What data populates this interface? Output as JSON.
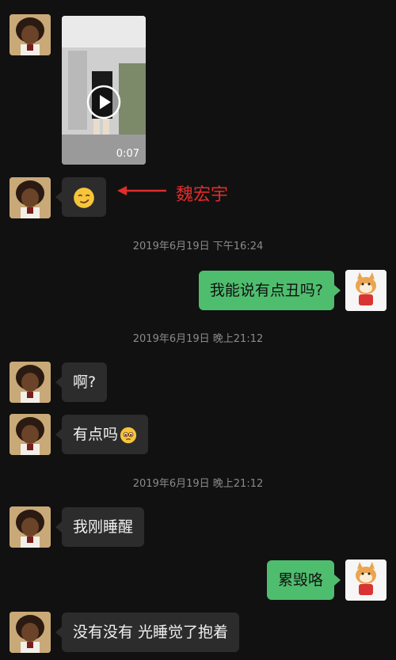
{
  "messages": {
    "video_duration": "0:07",
    "annotation_label": "魏宏宇",
    "ts1": "2019年6月19日 下午16:24",
    "msg_right1": "我能说有点丑吗?",
    "ts2": "2019年6月19日 晚上21:12",
    "msg_left1": "啊?",
    "msg_left2": "有点吗",
    "ts3": "2019年6月19日 晚上21:12",
    "msg_left3": "我刚睡醒",
    "msg_right2": "累毁咯",
    "msg_left4": "没有没有 光睡觉了抱着"
  },
  "colors": {
    "background": "#111111",
    "bubble_left": "#2c2c2c",
    "bubble_right": "#4fbd6e",
    "annotation": "#e02c2c",
    "timestamp": "#8a8a8a"
  },
  "icons": {
    "left_avatar": "cartoon-boy-avatar",
    "right_avatar": "shiba-dog-avatar",
    "play": "play-circle-icon",
    "emoji1": "smirk-emoji",
    "emoji2": "pleading-emoji"
  }
}
